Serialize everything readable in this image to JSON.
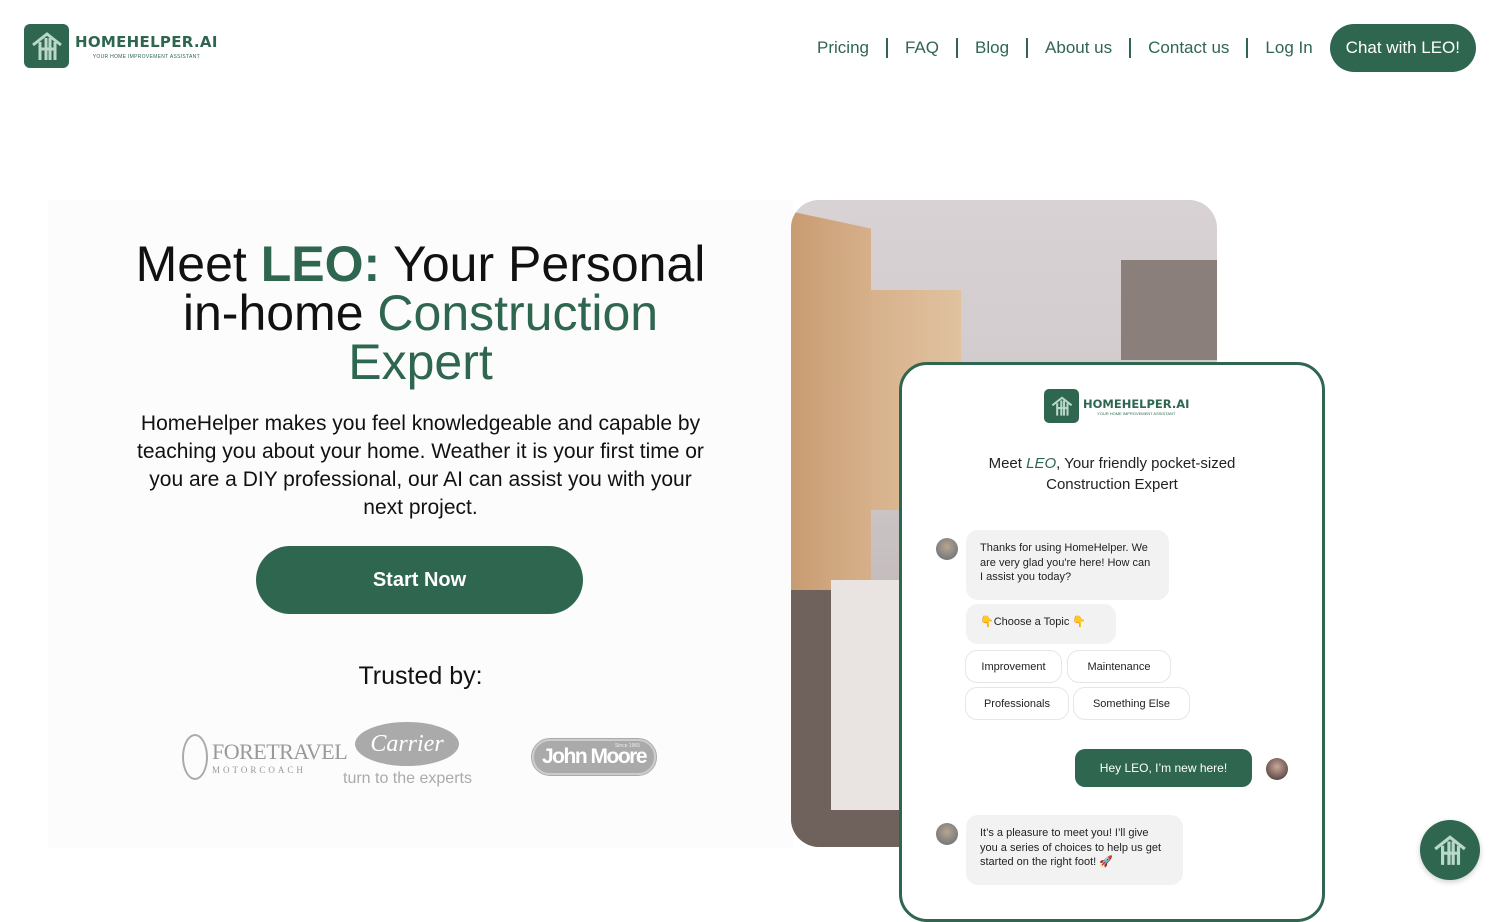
{
  "brand": {
    "name": "HOMEHELPER.AI",
    "tagline": "YOUR HOME IMPROVEMENT ASSISTANT",
    "color": "#2f6650"
  },
  "nav": {
    "items": [
      "Pricing",
      "FAQ",
      "Blog",
      "About us",
      "Contact us",
      "Log In"
    ],
    "cta": "Chat with LEO!"
  },
  "hero": {
    "title": {
      "p1": "Meet ",
      "p2": "LEO:",
      "p3": " Your Personal",
      "p4": "in-home ",
      "p5": "Construction",
      "p6": "Expert"
    },
    "subtitle": "HomeHelper makes you feel knowledgeable and capable by teaching you about your home. Weather it is your first time or you are a DIY professional, our AI can assist you with your next project.",
    "cta": "Start Now",
    "trusted_label": "Trusted by:",
    "brands": {
      "foretravel": "FORETRAVEL",
      "foretravel_sub": "MOTORCOACH",
      "carrier": "Carrier",
      "carrier_tag": "turn to the experts",
      "johnmoore": "John Moore",
      "johnmoore_since": "Since 1965"
    }
  },
  "phone": {
    "title_p1": "Meet ",
    "title_leo": "LEO",
    "title_p2": ", Your friendly pocket-sized",
    "title_p3": "Construction Expert",
    "bot_msg1": "Thanks for using HomeHelper. We are very glad you're here! How can I assist you today?",
    "topic_prompt": "👇Choose a Topic 👇",
    "topics": [
      "Improvement",
      "Maintenance",
      "Professionals",
      "Something Else"
    ],
    "user_msg": "Hey LEO, I’m new here!",
    "bot_msg2": "It’s a pleasure to meet you! I’ll give you a series of choices to help us get started on the right foot! 🚀"
  }
}
